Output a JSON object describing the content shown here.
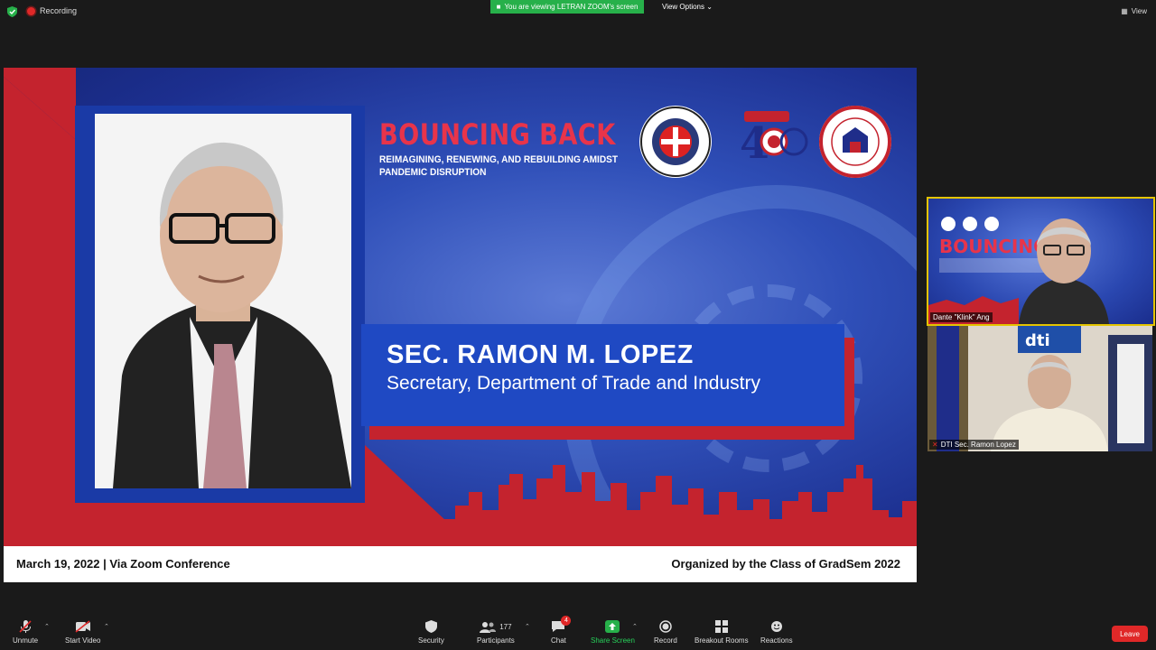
{
  "topbar": {
    "recording_label": "Recording",
    "viewing_banner": "You are viewing LETRAN ZOOM's screen",
    "view_options_label": "View Options",
    "view_label": "View"
  },
  "slide": {
    "title": "BOUNCING BACK",
    "subtitle": "REIMAGINING, RENEWING, AND REBUILDING AMIDST PANDEMIC DISRUPTION",
    "speaker_name": "SEC. RAMON M. LOPEZ",
    "speaker_role": "Secretary, Department of Trade and Industry",
    "footer_left": "March 19, 2022 | Via Zoom Conference",
    "footer_right": "Organized by the Class of GradSem 2022",
    "seal1_text": "DEUS LETRAN PATRIA 1620",
    "seal2_text": "Letran 400",
    "seal3_text": "Letran Graduate School MANILA"
  },
  "participants_tiles": [
    {
      "name": "Dante \"Klink\" Ang"
    },
    {
      "name": "DTI Sec. Ramon Lopez"
    }
  ],
  "toolbar": {
    "unmute": "Unmute",
    "start_video": "Start Video",
    "security": "Security",
    "participants": "Participants",
    "participants_count": "177",
    "chat": "Chat",
    "chat_badge": "4",
    "share_screen": "Share Screen",
    "record": "Record",
    "breakout_rooms": "Breakout Rooms",
    "reactions": "Reactions",
    "leave": "Leave"
  },
  "colors": {
    "share_green": "#27b04a",
    "recording_red": "#e02828",
    "slide_blue": "#1f49c3",
    "slide_red": "#c4232e",
    "active_speaker_border": "#e4c400"
  }
}
